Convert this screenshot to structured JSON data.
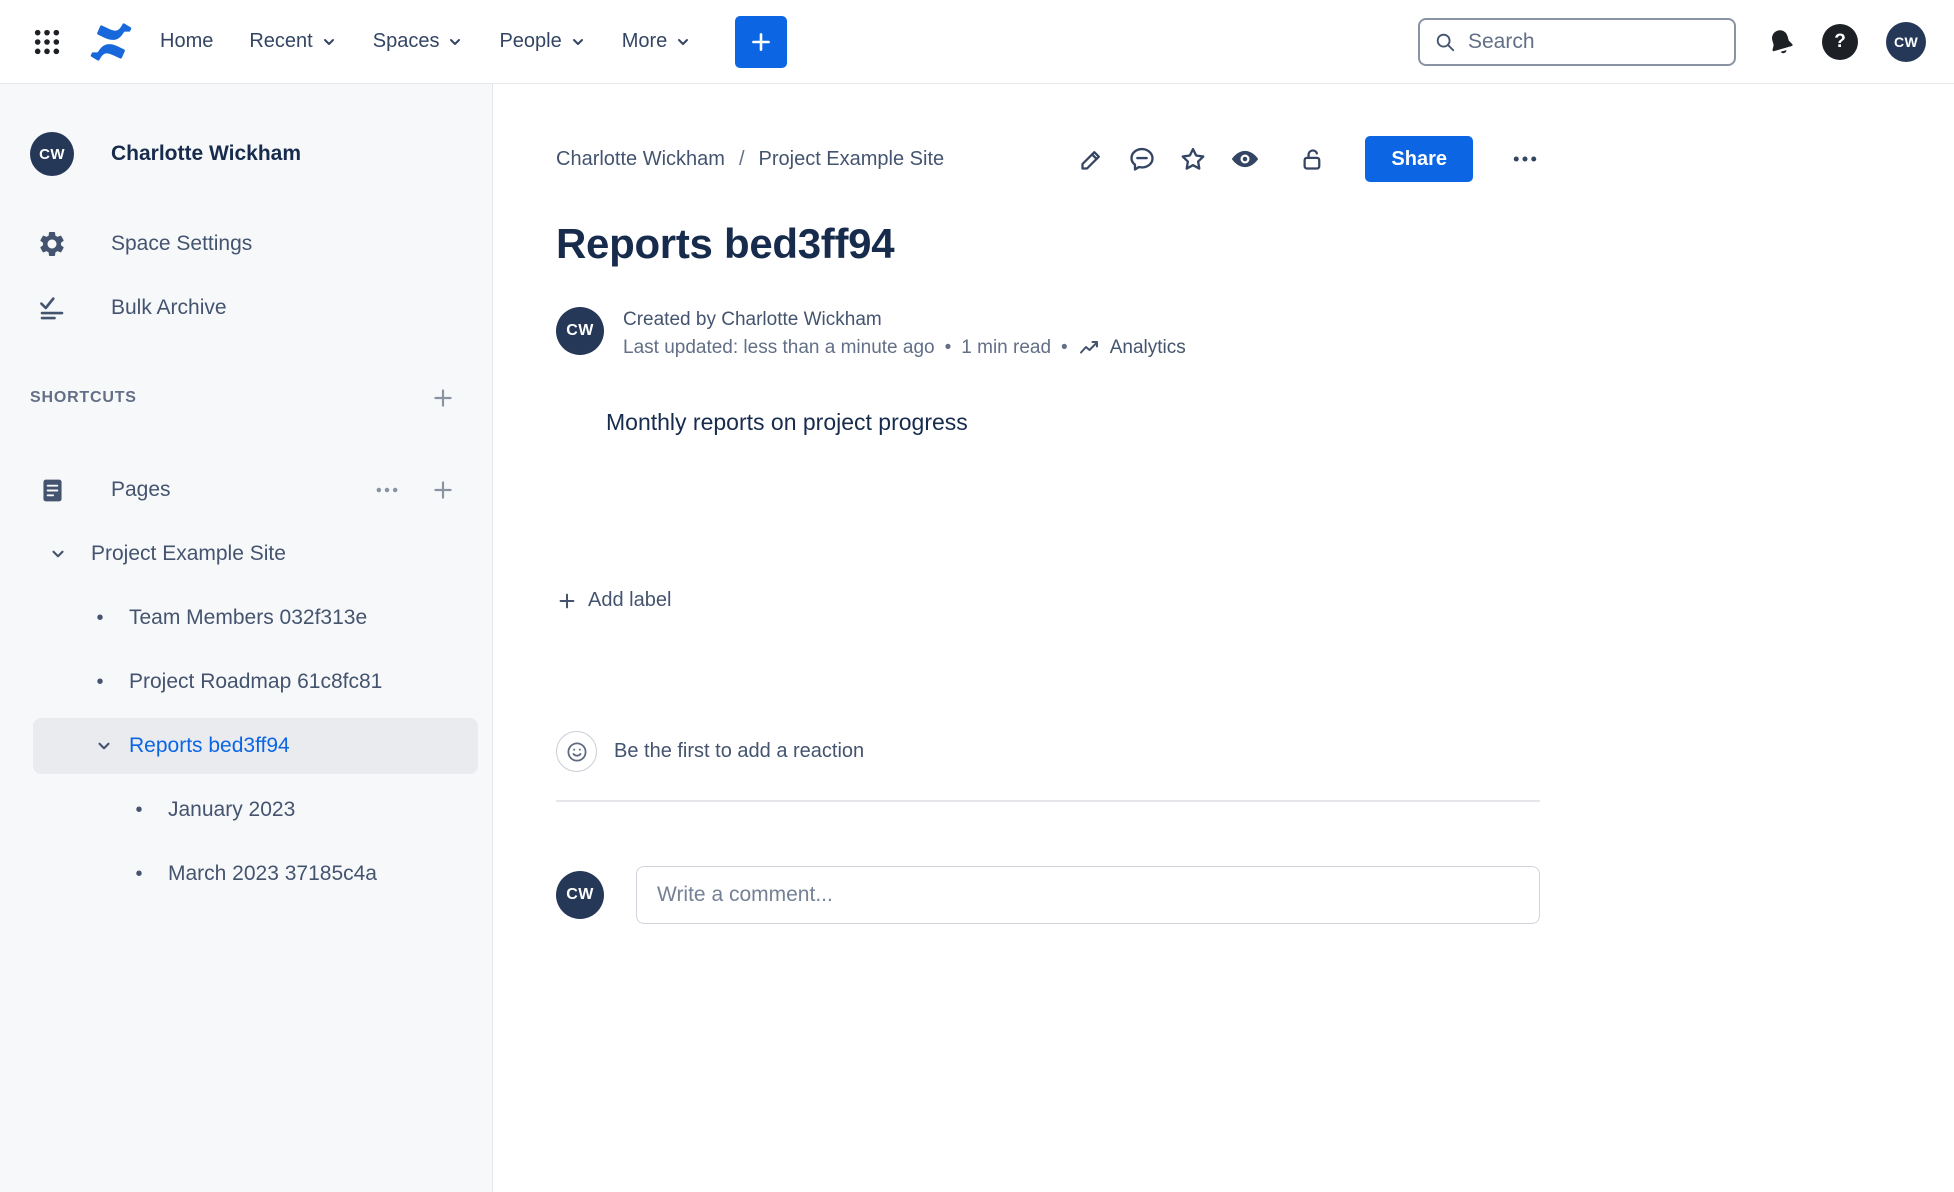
{
  "colors": {
    "brand_blue": "#0C66E4",
    "link_blue": "#0C66E4",
    "avatar_navy": "#253858",
    "text_dark": "#172B4D",
    "text_gray": "#44546F",
    "text_muted": "#626F86",
    "sidebar_bg": "#F7F8FA",
    "selected_item_bg": "#E9EBEE"
  },
  "topnav": {
    "app_switcher_icon": "grid-3x3",
    "logo_icon": "confluence-logo",
    "items": [
      {
        "label": "Home",
        "has_dropdown": false
      },
      {
        "label": "Recent",
        "has_dropdown": true
      },
      {
        "label": "Spaces",
        "has_dropdown": true
      },
      {
        "label": "People",
        "has_dropdown": true
      },
      {
        "label": "More",
        "has_dropdown": true
      }
    ],
    "create_button_icon": "plus",
    "search": {
      "placeholder": "Search",
      "icon": "magnifier"
    },
    "notifications_icon": "bell",
    "help_label": "?",
    "avatar_initials": "CW"
  },
  "sidebar": {
    "avatar_initials": "CW",
    "space_name": "Charlotte Wickham",
    "menu": [
      {
        "label": "Space Settings",
        "icon": "gear"
      },
      {
        "label": "Bulk Archive",
        "icon": "bulk-archive-check"
      }
    ],
    "shortcuts": {
      "heading": "SHORTCUTS",
      "add_icon": "plus"
    },
    "pages": {
      "heading": "Pages",
      "icon": "document",
      "more_icon": "more-horizontal",
      "add_icon": "plus"
    },
    "tree": [
      {
        "label": "Project Example Site",
        "marker": "chevron-down",
        "level": 0,
        "selected": false
      },
      {
        "label": "Team Members 032f313e",
        "marker": "bullet",
        "level": 1,
        "selected": false
      },
      {
        "label": "Project Roadmap 61c8fc81",
        "marker": "bullet",
        "level": 1,
        "selected": false
      },
      {
        "label": "Reports bed3ff94",
        "marker": "chevron-down",
        "level": 1,
        "selected": true
      },
      {
        "label": "January 2023",
        "marker": "bullet",
        "level": 2,
        "selected": false
      },
      {
        "label": "March 2023 37185c4a",
        "marker": "bullet",
        "level": 2,
        "selected": false
      }
    ]
  },
  "content": {
    "breadcrumb": {
      "crumb1": "Charlotte Wickham",
      "separator": "/",
      "crumb2": "Project Example Site"
    },
    "actions": {
      "icons": [
        "edit-pencil",
        "inline-comment",
        "star",
        "watch-eye",
        "unlock",
        "more-horizontal"
      ],
      "share_label": "Share"
    },
    "page_title": "Reports bed3ff94",
    "byline": {
      "avatar_initials": "CW",
      "created": "Created by Charlotte Wickham",
      "last_updated": "Last updated: less than a minute ago",
      "separator": "•",
      "read_time": "1 min read",
      "analytics_label": "Analytics",
      "analytics_icon": "trend-chart"
    },
    "body_paragraph": "Monthly reports on project progress",
    "labels": {
      "add_label": "Add label",
      "icon": "plus"
    },
    "reactions": {
      "prompt": "Be the first to add a reaction",
      "icon": "smiley"
    },
    "comment": {
      "avatar_initials": "CW",
      "placeholder": "Write a comment..."
    }
  }
}
